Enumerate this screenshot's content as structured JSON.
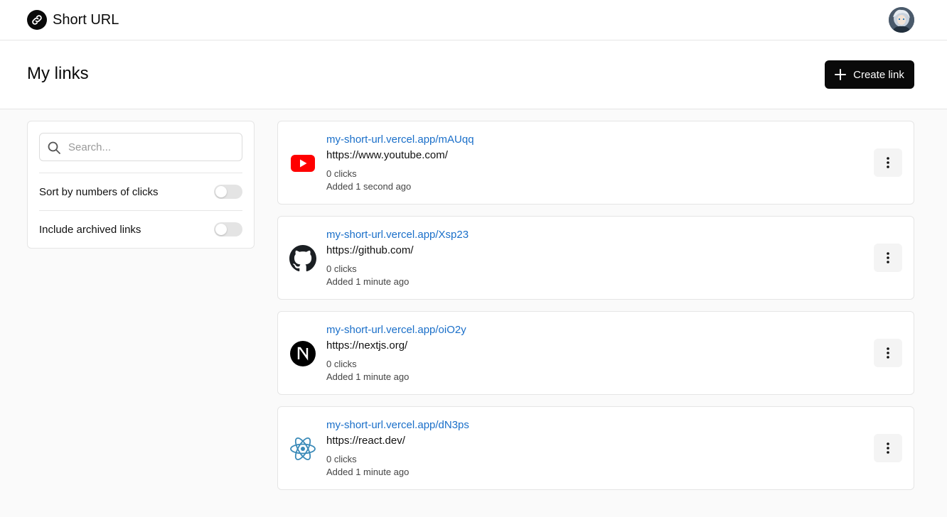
{
  "app": {
    "name": "Short URL",
    "brand_icon": "link-icon"
  },
  "user": {
    "avatar": "user-avatar"
  },
  "page": {
    "title": "My links",
    "create_label": "Create link"
  },
  "filters": {
    "search_placeholder": "Search...",
    "search_value": "",
    "sort_label": "Sort by numbers of clicks",
    "sort_on": false,
    "archived_label": "Include archived links",
    "archived_on": false
  },
  "links": [
    {
      "short": "my-short-url.vercel.app/mAUqq",
      "target": "https://www.youtube.com/",
      "clicks": "0 clicks",
      "added": "Added 1 second ago",
      "icon": "youtube-icon"
    },
    {
      "short": "my-short-url.vercel.app/Xsp23",
      "target": "https://github.com/",
      "clicks": "0 clicks",
      "added": "Added 1 minute ago",
      "icon": "github-icon"
    },
    {
      "short": "my-short-url.vercel.app/oiO2y",
      "target": "https://nextjs.org/",
      "clicks": "0 clicks",
      "added": "Added 1 minute ago",
      "icon": "nextjs-icon"
    },
    {
      "short": "my-short-url.vercel.app/dN3ps",
      "target": "https://react.dev/",
      "clicks": "0 clicks",
      "added": "Added 1 minute ago",
      "icon": "react-icon"
    }
  ],
  "colors": {
    "accent_link": "#1a6fc9",
    "primary_button": "#0a0a0a",
    "youtube_red": "#ff0000",
    "react_blue": "#3a8ab8"
  }
}
